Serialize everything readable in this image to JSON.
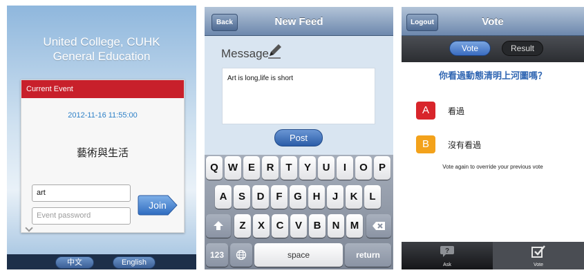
{
  "screen1": {
    "title_line1": "United College, CUHK",
    "title_line2": "General Education",
    "card_header": "Current Event",
    "datetime": "2012-11-16 11:55:00",
    "event_name": "藝術與生活",
    "event_field_value": "art",
    "password_placeholder": "Event password",
    "join_label": "Join",
    "lang_chinese": "中文",
    "lang_english": "English"
  },
  "screen2": {
    "back_label": "Back",
    "title": "New Feed",
    "message_label": "Message",
    "message_text": "Art is long,life is short",
    "post_label": "Post",
    "keyboard": {
      "row1": [
        "Q",
        "W",
        "E",
        "R",
        "T",
        "Y",
        "U",
        "I",
        "O",
        "P"
      ],
      "row2": [
        "A",
        "S",
        "D",
        "F",
        "G",
        "H",
        "J",
        "K",
        "L"
      ],
      "row3": [
        "Z",
        "X",
        "C",
        "V",
        "B",
        "N",
        "M"
      ],
      "numbers_label": "123",
      "space_label": "space",
      "return_label": "return"
    }
  },
  "screen3": {
    "logout_label": "Logout",
    "title": "Vote",
    "seg_vote": "Vote",
    "seg_result": "Result",
    "question": "你看過動態清明上河圖嗎？",
    "options": [
      {
        "letter": "A",
        "text": "看過",
        "color": "#d8252b"
      },
      {
        "letter": "B",
        "text": "沒有看過",
        "color": "#f3a21b"
      }
    ],
    "note": "Vote again to override your previous vote",
    "tabs": [
      {
        "label": "Ask",
        "icon": "ask-icon"
      },
      {
        "label": "Vote",
        "icon": "vote-icon"
      }
    ]
  }
}
